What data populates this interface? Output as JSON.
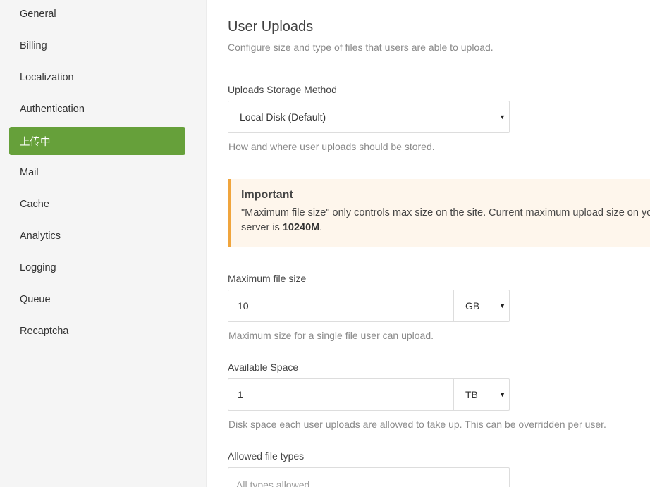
{
  "sidebar": {
    "items": [
      {
        "label": "General"
      },
      {
        "label": "Billing"
      },
      {
        "label": "Localization"
      },
      {
        "label": "Authentication"
      },
      {
        "label": "上传中",
        "active": true
      },
      {
        "label": "Mail"
      },
      {
        "label": "Cache"
      },
      {
        "label": "Analytics"
      },
      {
        "label": "Logging"
      },
      {
        "label": "Queue"
      },
      {
        "label": "Recaptcha"
      }
    ]
  },
  "main": {
    "title": "User Uploads",
    "subtitle": "Configure size and type of files that users are able to upload.",
    "storage": {
      "label": "Uploads Storage Method",
      "value": "Local Disk (Default)",
      "help": "How and where user uploads should be stored."
    },
    "alert": {
      "title": "Important",
      "body_line1": "\"Maximum file size\" only controls max size on the site. Current maximum upload size on your",
      "body_line2_prefix": "server is ",
      "body_line2_value": "10240M",
      "body_line2_suffix": "."
    },
    "max_file_size": {
      "label": "Maximum file size",
      "value": "10",
      "unit": "GB",
      "help": "Maximum size for a single file user can upload."
    },
    "available_space": {
      "label": "Available Space",
      "value": "1",
      "unit": "TB",
      "help": "Disk space each user uploads are allowed to take up. This can be overridden per user."
    },
    "allowed_types": {
      "label": "Allowed file types",
      "placeholder": "All types allowed"
    }
  },
  "colors": {
    "active_nav": "#66a03a",
    "alert_border": "#f0a53d",
    "alert_bg": "#fef6ec"
  }
}
